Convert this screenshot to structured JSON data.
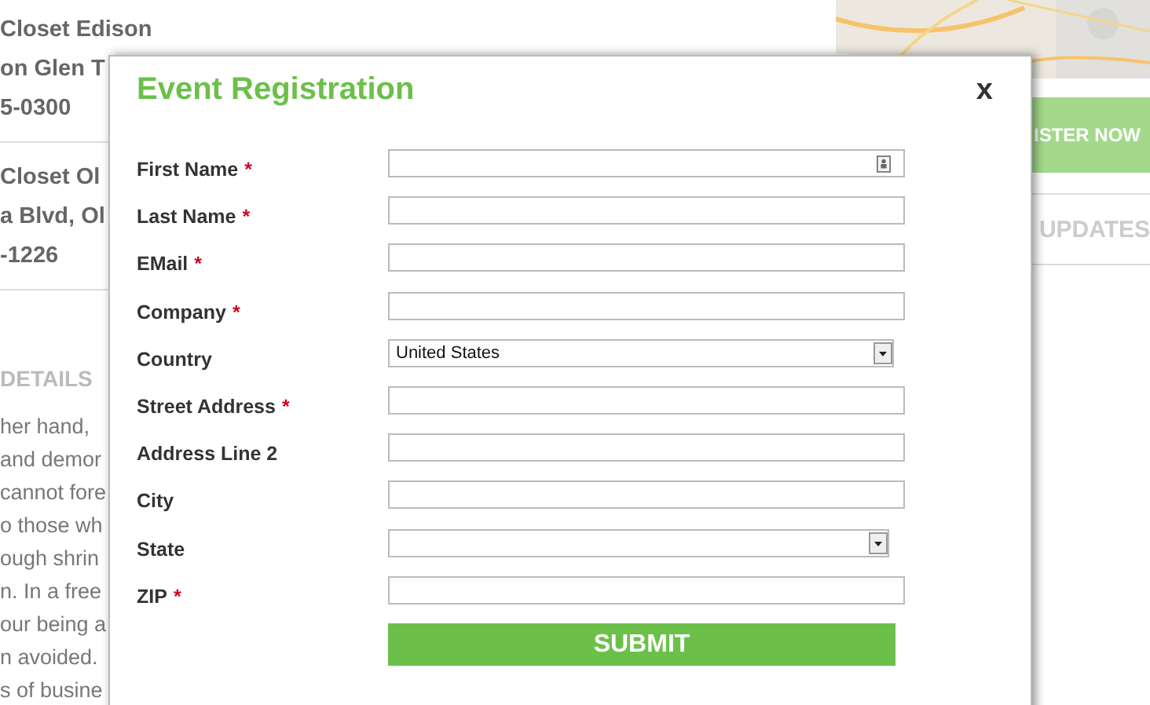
{
  "background": {
    "locations": [
      {
        "lines": [
          "Closet Edison",
          "on Glen T",
          "5-0300"
        ]
      },
      {
        "lines": [
          "Closet Ol",
          "a Blvd, Ol",
          "-1226"
        ]
      }
    ],
    "details_heading": "DETAILS",
    "details_lines": [
      "her hand,",
      "and demor",
      "cannot fore",
      "o those wh",
      "ough shrin",
      "n. In a free",
      "our being a",
      "n avoided.",
      "s of busine"
    ],
    "register_button": "ISTER NOW",
    "updates_button": "UPDATES"
  },
  "modal": {
    "title": "Event Registration",
    "close": "x",
    "required_mark": "*",
    "fields": [
      {
        "kind": "text",
        "label": "First Name",
        "required": true,
        "contact_icon": true
      },
      {
        "kind": "text",
        "label": "Last Name",
        "required": true
      },
      {
        "kind": "text",
        "label": "EMail",
        "required": true
      },
      {
        "kind": "text",
        "label": "Company",
        "required": true
      },
      {
        "kind": "select",
        "label": "Country",
        "required": false,
        "value": "United States"
      },
      {
        "kind": "text",
        "label": "Street Address",
        "required": true
      },
      {
        "kind": "text",
        "label": "Address Line 2",
        "required": false
      },
      {
        "kind": "text",
        "label": "City",
        "required": false
      },
      {
        "kind": "select",
        "label": "State",
        "required": false
      },
      {
        "kind": "text",
        "label": "ZIP",
        "required": true
      }
    ],
    "submit": "SUBMIT"
  }
}
